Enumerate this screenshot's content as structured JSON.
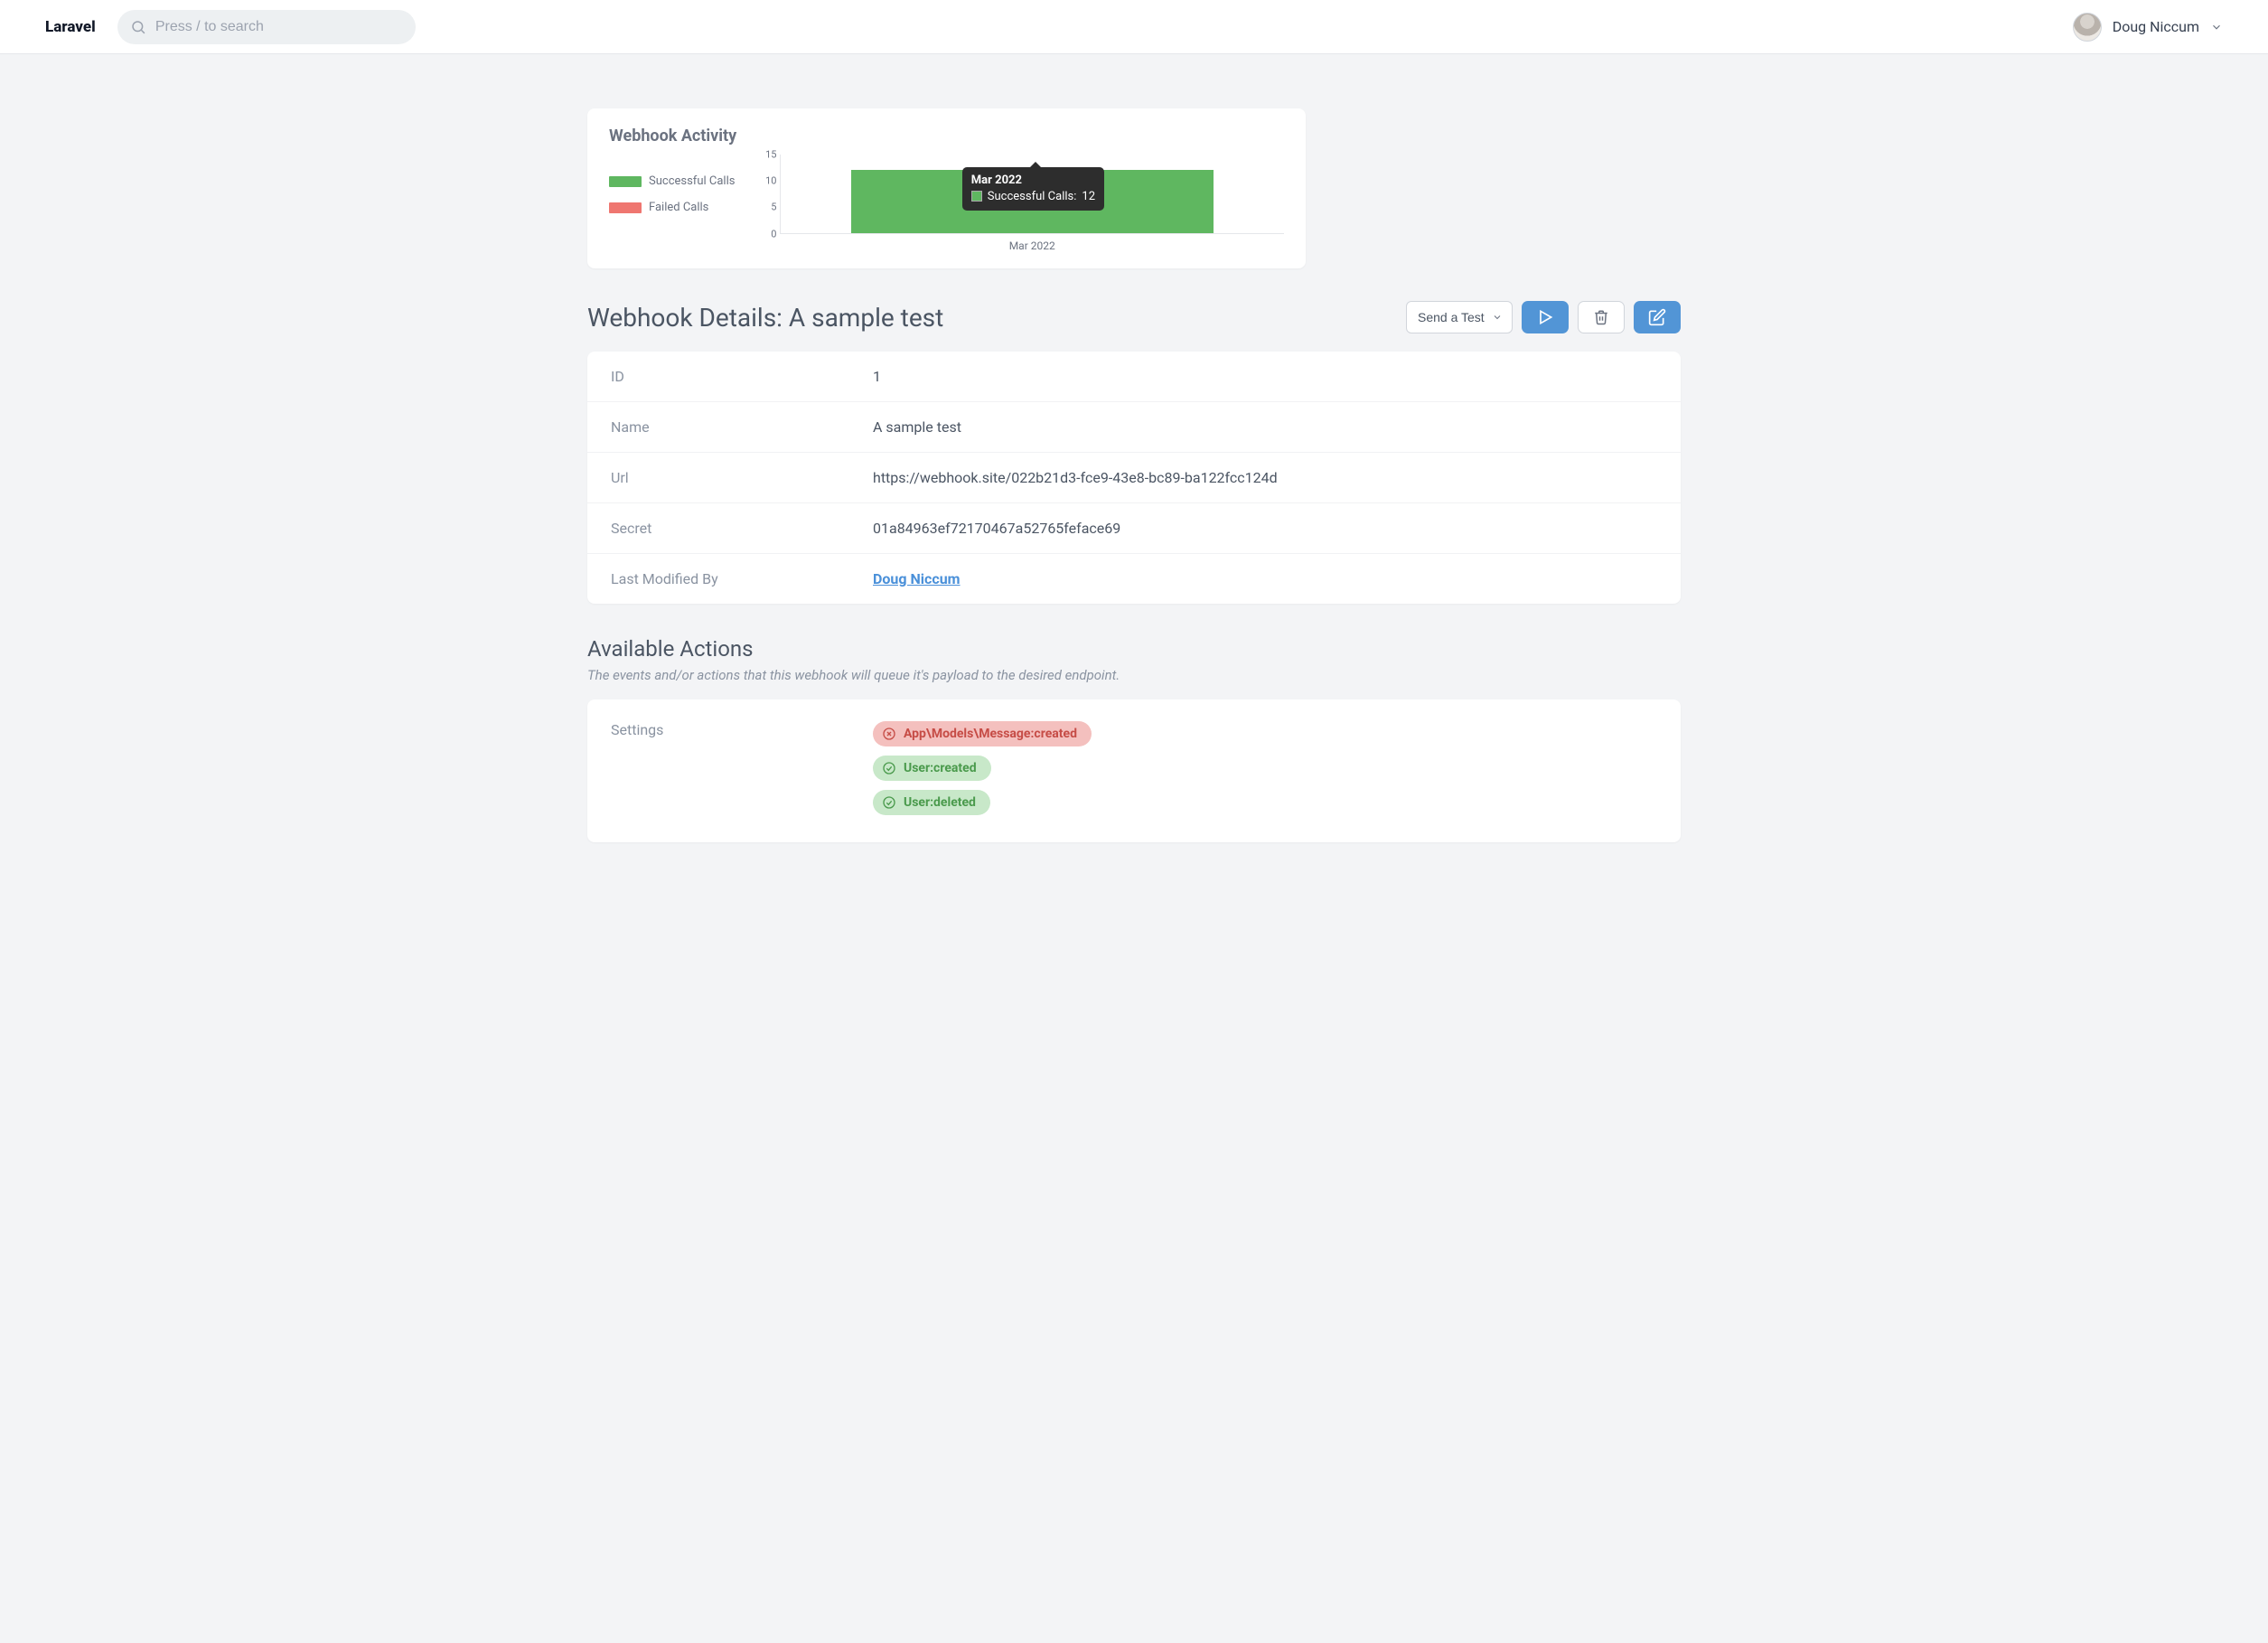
{
  "brand": "Laravel",
  "search": {
    "placeholder": "Press / to search"
  },
  "user": {
    "name": "Doug Niccum"
  },
  "chart": {
    "title": "Webhook Activity",
    "legend": {
      "success": "Successful Calls",
      "failed": "Failed Calls"
    },
    "tooltip": {
      "period": "Mar 2022",
      "series_label": "Successful Calls:",
      "value": "12"
    },
    "x_label": "Mar 2022",
    "y_ticks": {
      "t0": "0",
      "t5": "5",
      "t10": "10",
      "t15": "15"
    }
  },
  "chart_data": {
    "type": "bar",
    "categories": [
      "Mar 2022"
    ],
    "series": [
      {
        "name": "Successful Calls",
        "color": "#5fb760",
        "values": [
          12
        ]
      },
      {
        "name": "Failed Calls",
        "color": "#ef7670",
        "values": [
          0
        ]
      }
    ],
    "ylim": [
      0,
      15
    ],
    "xlabel": "",
    "ylabel": "",
    "title": "Webhook Activity"
  },
  "heading": {
    "prefix": "Webhook Details: ",
    "name": "A sample test",
    "send_test": "Send a Test"
  },
  "details": {
    "labels": {
      "id": "ID",
      "name": "Name",
      "url": "Url",
      "secret": "Secret",
      "modified_by": "Last Modified By"
    },
    "values": {
      "id": "1",
      "name": "A sample test",
      "url": "https://webhook.site/022b21d3-fce9-43e8-bc89-ba122fcc124d",
      "secret": "01a84963ef72170467a52765feface69",
      "modified_by": "Doug Niccum"
    }
  },
  "actions": {
    "title": "Available Actions",
    "subtitle": "The events and/or actions that this webhook will queue it's payload to the desired endpoint.",
    "settings_label": "Settings",
    "items": [
      {
        "label": "App\\Models\\Message:created",
        "status": "error"
      },
      {
        "label": "User:created",
        "status": "ok"
      },
      {
        "label": "User:deleted",
        "status": "ok"
      }
    ]
  }
}
